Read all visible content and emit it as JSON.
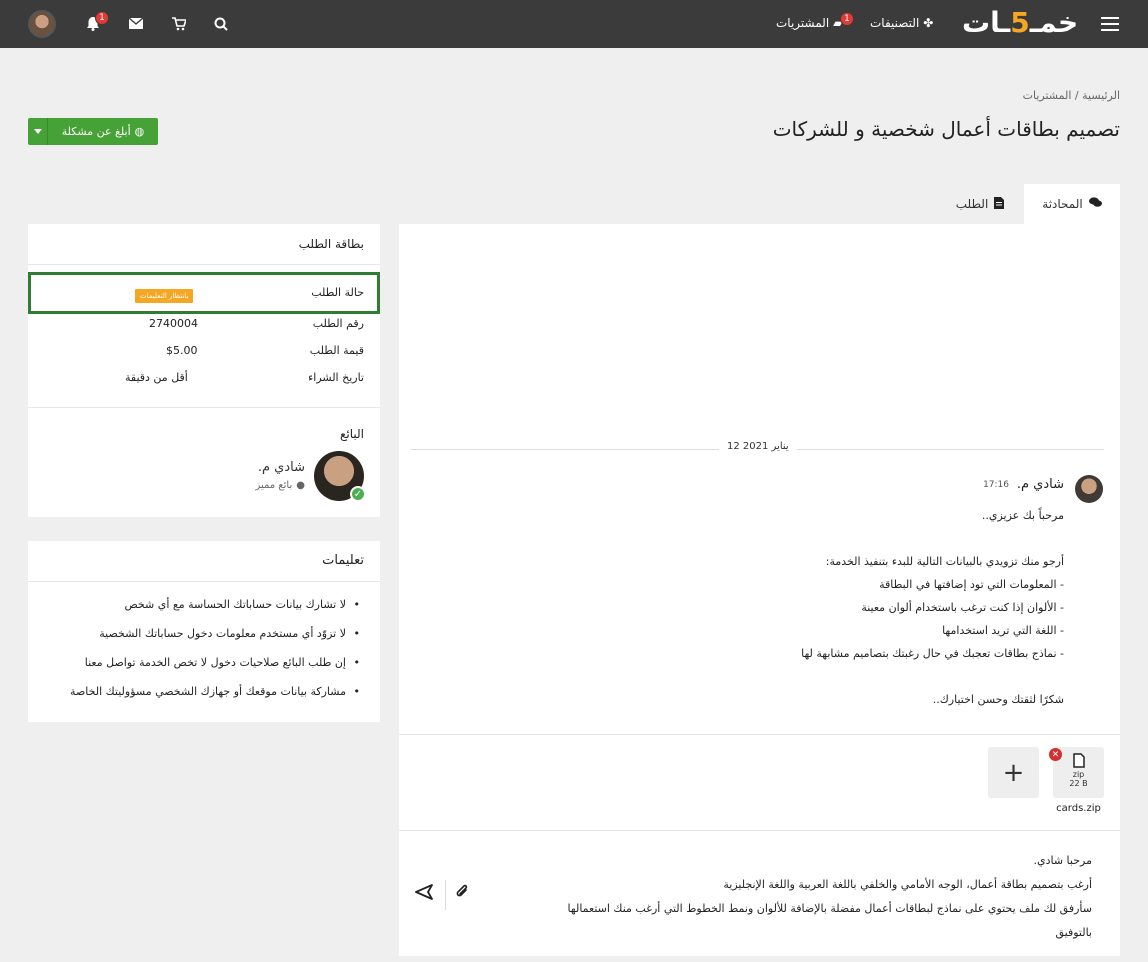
{
  "topbar": {
    "logo_text": "خمسات",
    "categories": "التصنيفات",
    "purchases": "المشتريات",
    "purchases_badge": "1",
    "notifications_badge": "1",
    "icons": [
      "menu-icon",
      "categories-icon",
      "folder-icon",
      "search-icon",
      "cart-icon",
      "envelope-icon",
      "bell-icon"
    ]
  },
  "header": {
    "breadcrumb_home": "الرئيسية",
    "breadcrumb_sep": "/",
    "breadcrumb_current": "المشتريات",
    "title": "تصميم بطاقات أعمال شخصية و للشركات",
    "report_button": "أبلغ عن مشكلة"
  },
  "tabs": [
    {
      "label": "المحادثة",
      "icon": "comments-icon",
      "active": true
    },
    {
      "label": "الطلب",
      "icon": "file-icon",
      "active": false
    }
  ],
  "chat": {
    "date": "12 يناير 2021",
    "message": {
      "author": "شادي م.",
      "time": "17:16",
      "lines": [
        "مرحباً بك عزيزي..",
        "",
        "أرجو منك تزويدي بالبيانات التالية للبدء بتنفيذ الخدمة:",
        "- المعلومات التي تود إضافتها في البطاقة",
        "- الألوان إذا كنت ترغب باستخدام ألوان معينة",
        "- اللغة التي تريد استخدامها",
        "- نماذج بطاقات تعجبك في حال رغبتك بتصاميم مشابهة لها",
        "",
        "شكرًا لثقتك وحسن اختيارك.."
      ]
    },
    "attachment": {
      "ext": "zip",
      "size": "22 B",
      "name": "cards.zip"
    },
    "reply_lines": [
      "مرحبا شادي.",
      "أرغب بتصميم بطاقة أعمال، الوجه الأمامي والخلفي باللغة العربية واللغة الإنجليزية",
      "سأرفق لك ملف يحتوي على نماذج لبطاقات أعمال مفضلة بالإضافة للألوان ونمط الخطوط التي أرغب منك استعمالها",
      "بالتوفيق"
    ]
  },
  "order_card": {
    "title": "بطاقة الطلب",
    "status_label": "حالة الطلب",
    "status_value": "بانتظار التعليمات",
    "number_label": "رقم الطلب",
    "number_value": "2740004",
    "price_label": "قيمة الطلب",
    "price_value": "$5.00",
    "date_label": "تاريخ الشراء",
    "date_value": "أقل من دقيقة",
    "seller_label": "البائع",
    "seller_name": "شادي م.",
    "seller_level": "بائع مميز"
  },
  "instructions": {
    "title": "تعليمات",
    "items": [
      "لا تشارك بيانات حساباتك الحساسة مع أي شخص",
      "لا تزوّد أي مستخدم معلومات دخول حساباتك الشخصية",
      "إن طلب البائع صلاحيات دخول لا تخص الخدمة تواصل معنا",
      "مشاركة بيانات موقعك أو جهازك الشخصي مسؤوليتك الخاصة"
    ]
  }
}
